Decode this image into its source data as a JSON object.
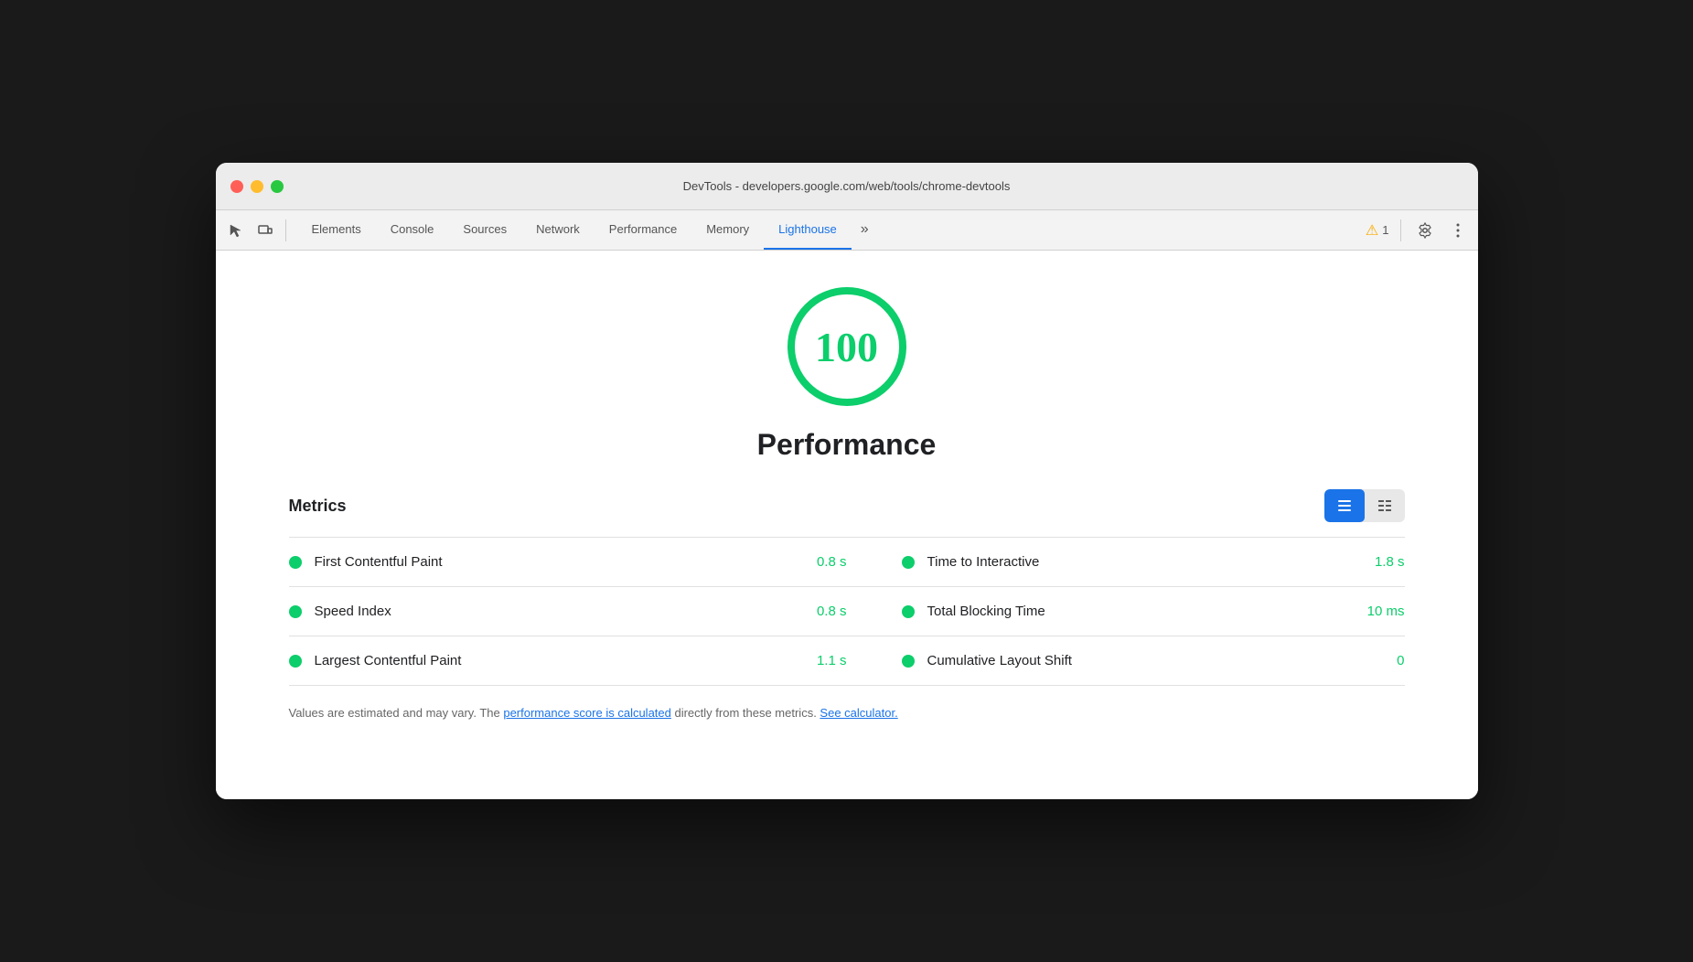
{
  "window": {
    "title": "DevTools - developers.google.com/web/tools/chrome-devtools"
  },
  "toolbar": {
    "icons": {
      "inspect": "⬡",
      "device": "▣"
    },
    "tabs": [
      {
        "id": "elements",
        "label": "Elements",
        "active": false
      },
      {
        "id": "console",
        "label": "Console",
        "active": false
      },
      {
        "id": "sources",
        "label": "Sources",
        "active": false
      },
      {
        "id": "network",
        "label": "Network",
        "active": false
      },
      {
        "id": "performance",
        "label": "Performance",
        "active": false
      },
      {
        "id": "memory",
        "label": "Memory",
        "active": false
      },
      {
        "id": "lighthouse",
        "label": "Lighthouse",
        "active": true
      }
    ],
    "more": "»",
    "warning_count": "1",
    "settings_icon": "⚙",
    "more_icon": "⋮"
  },
  "score": {
    "value": "100",
    "label": "Performance"
  },
  "metrics": {
    "title": "Metrics",
    "rows": [
      {
        "left_name": "First Contentful Paint",
        "left_value": "0.8 s",
        "right_name": "Time to Interactive",
        "right_value": "1.8 s"
      },
      {
        "left_name": "Speed Index",
        "left_value": "0.8 s",
        "right_name": "Total Blocking Time",
        "right_value": "10 ms"
      },
      {
        "left_name": "Largest Contentful Paint",
        "left_value": "1.1 s",
        "right_name": "Cumulative Layout Shift",
        "right_value": "0"
      }
    ],
    "view_grid_label": "≡",
    "view_list_label": "☰"
  },
  "footer": {
    "text_before_link1": "Values are estimated and may vary. The ",
    "link1_text": "performance score is calculated",
    "text_between": " directly from these metrics. ",
    "link2_text": "See calculator.",
    "text_end": ""
  },
  "colors": {
    "green": "#0cce6b",
    "blue": "#1a73e8",
    "warning": "#f9ab00"
  }
}
